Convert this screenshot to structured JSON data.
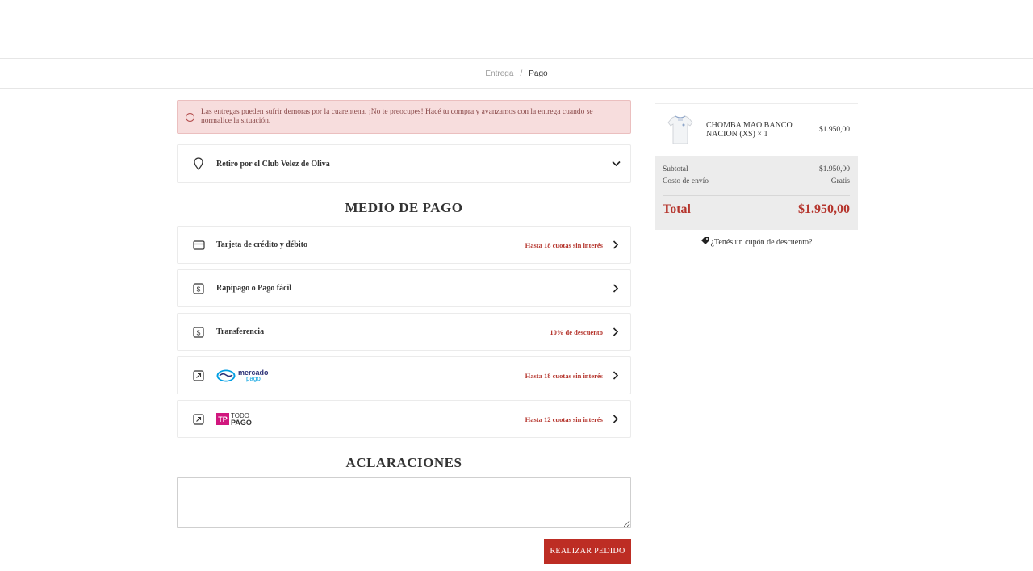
{
  "breadcrumb": {
    "step1": "Entrega",
    "separator": "/",
    "step2": "Pago"
  },
  "alert": {
    "icon": "info-circle-icon",
    "text": "Las entregas pueden sufrir demoras por la cuarentena. ¡No te preocupes! Hacé tu compra y avanzamos con la entrega cuando se normalice la situación."
  },
  "shipping": {
    "icon": "location-pin-icon",
    "label": "Retiro por el Club Velez de Oliva"
  },
  "payment": {
    "title": "MEDIO DE PAGO",
    "options": [
      {
        "icon": "credit-card-icon",
        "label": "Tarjeta de crédito y débito",
        "promo": "Hasta 18 cuotas sin interés"
      },
      {
        "icon": "cash-icon",
        "label": "Rapipago o Pago fácil",
        "promo": ""
      },
      {
        "icon": "cash-icon",
        "label": "Transferencia",
        "promo": "10% de descuento"
      },
      {
        "icon": "external-link-icon",
        "logo": {
          "line1": "mercado",
          "line2": "pago"
        },
        "promo": "Hasta 18 cuotas sin interés"
      },
      {
        "icon": "external-link-icon",
        "logo": {
          "badge": "TP",
          "line1": "TODO",
          "line2": "PAGO"
        },
        "promo": "Hasta 12 cuotas sin interés"
      }
    ]
  },
  "notes": {
    "title": "ACLARACIONES",
    "value": "",
    "placeholder": ""
  },
  "submit": {
    "label": "REALIZAR PEDIDO"
  },
  "cart": {
    "item": {
      "name": "CHOMBA MAO BANCO NACION (XS) × 1",
      "price": "$1.950,00"
    },
    "subtotal_label": "Subtotal",
    "subtotal_value": "$1.950,00",
    "shipping_label": "Costo de envío",
    "shipping_value": "Gratis",
    "total_label": "Total",
    "total_value": "$1.950,00",
    "coupon": "¿Tenés un cupón de descuento?"
  },
  "colors": {
    "accent": "#bd2d24",
    "alert_bg": "#f7dddd",
    "summary_bg": "#ececec",
    "mercadopago_blue": "#2d3277",
    "todopago_pink": "#d1177e"
  }
}
